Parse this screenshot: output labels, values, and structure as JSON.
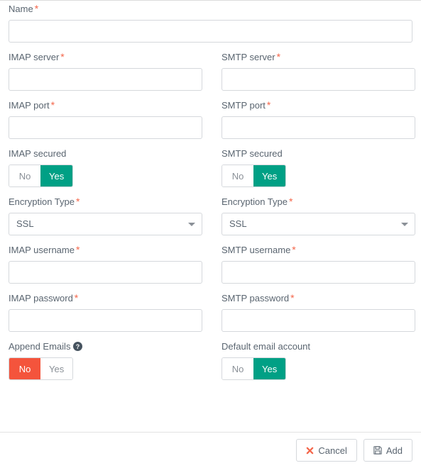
{
  "colors": {
    "toggle_on_green": "#00a085",
    "toggle_on_red": "#f4543c",
    "required_asterisk": "#f4664a",
    "label_text": "#5a6570",
    "input_border": "#d5d8dc",
    "cancel_icon": "#f4664a"
  },
  "form": {
    "name_field": {
      "label": "Name",
      "required": "*",
      "value": "",
      "placeholder": ""
    },
    "left_column": {
      "imap_server": {
        "label": "IMAP server",
        "required": "*",
        "value": "",
        "placeholder": ""
      },
      "imap_port": {
        "label": "IMAP port",
        "required": "*",
        "value": "",
        "placeholder": ""
      },
      "imap_secured": {
        "label": "IMAP secured",
        "options": [
          "No",
          "Yes"
        ],
        "selected": "Yes"
      },
      "imap_encryption_type": {
        "label": "Encryption Type",
        "required": "*",
        "selected": "SSL",
        "icon": "chevron-down-icon"
      },
      "imap_username": {
        "label": "IMAP username",
        "required": "*",
        "value": "",
        "placeholder": ""
      },
      "imap_password": {
        "label": "IMAP password",
        "required": "*",
        "value": "",
        "placeholder": ""
      },
      "append_emails": {
        "label": "Append Emails",
        "help_icon": "help-circle-icon",
        "options": [
          "No",
          "Yes"
        ],
        "selected": "No"
      }
    },
    "right_column": {
      "smtp_server": {
        "label": "SMTP server",
        "required": "*",
        "value": "",
        "placeholder": ""
      },
      "smtp_port": {
        "label": "SMTP port",
        "required": "*",
        "value": "",
        "placeholder": ""
      },
      "smtp_secured": {
        "label": "SMTP secured",
        "options": [
          "No",
          "Yes"
        ],
        "selected": "Yes"
      },
      "smtp_encryption_type": {
        "label": "Encryption Type",
        "required": "*",
        "selected": "SSL",
        "icon": "chevron-down-icon"
      },
      "smtp_username": {
        "label": "SMTP username",
        "required": "*",
        "value": "",
        "placeholder": ""
      },
      "smtp_password": {
        "label": "SMTP password",
        "required": "*",
        "value": "",
        "placeholder": ""
      },
      "default_email_account": {
        "label": "Default email account",
        "options": [
          "No",
          "Yes"
        ],
        "selected": "Yes"
      }
    }
  },
  "footer": {
    "cancel_label": "Cancel",
    "cancel_icon": "close-x-icon",
    "add_label": "Add",
    "add_icon": "save-floppy-icon"
  }
}
